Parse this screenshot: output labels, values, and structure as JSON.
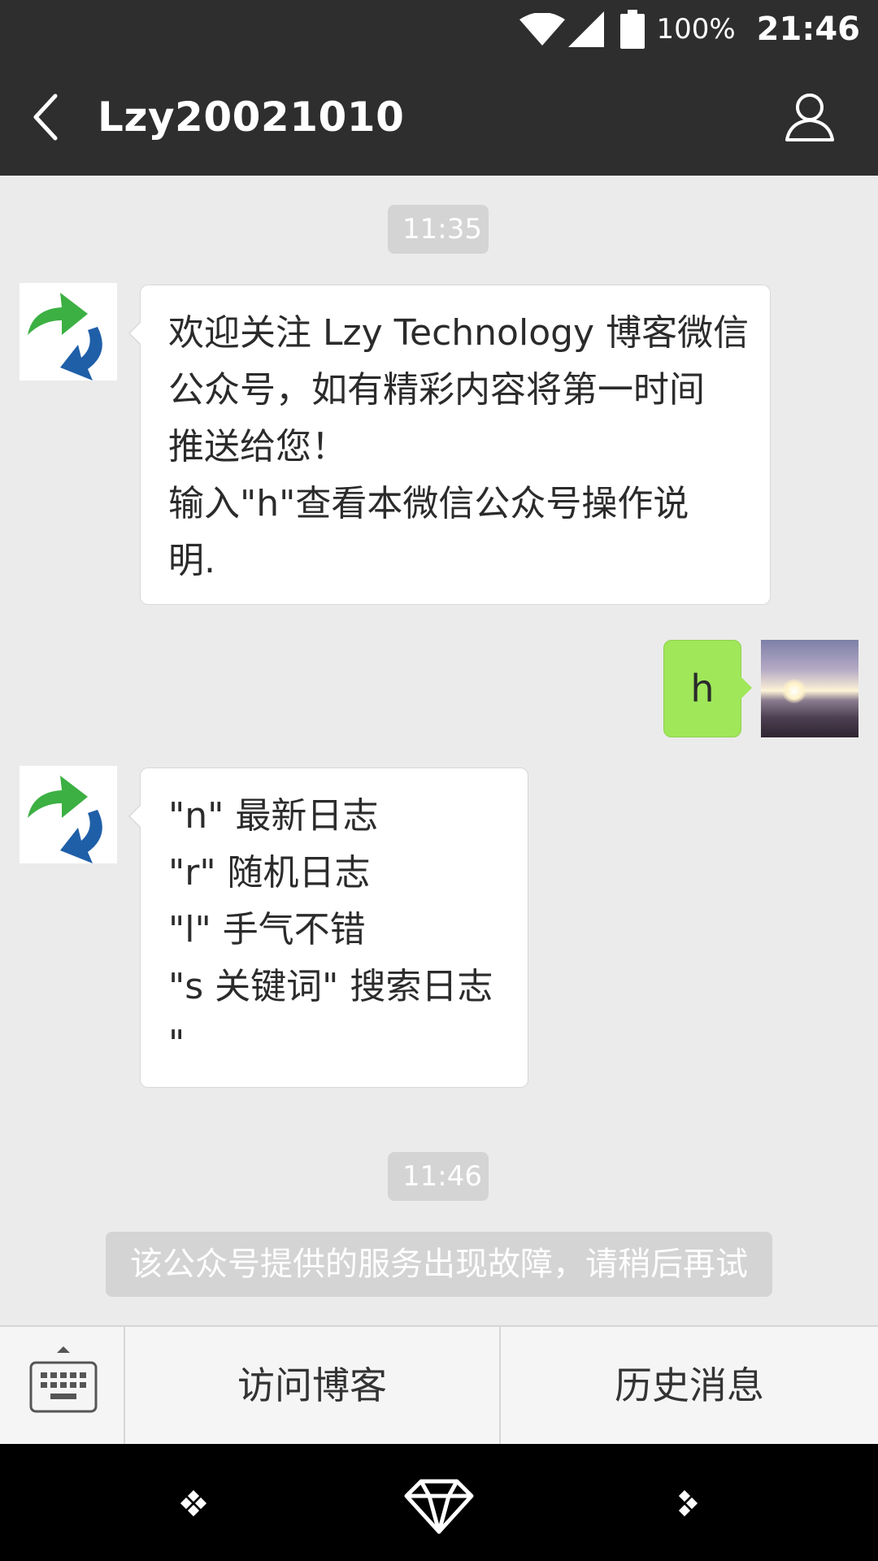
{
  "status_bar": {
    "battery": "100%",
    "time": "21:46",
    "icons": [
      "wifi-icon",
      "signal-icon",
      "battery-icon"
    ]
  },
  "header": {
    "title": "Lzy20021010",
    "back_icon": "chevron-left-icon",
    "profile_icon": "person-icon"
  },
  "chat": {
    "timestamps": [
      "11:35",
      "11:46"
    ],
    "messages": [
      {
        "from": "official-account",
        "lines": [
          "欢迎关注 Lzy Technology 博客微信",
          "公众号，如有精彩内容将第一时间",
          "推送给您！",
          "输入\"h\"查看本微信公众号操作说",
          "明."
        ]
      },
      {
        "from": "me",
        "lines": [
          "h"
        ]
      },
      {
        "from": "official-account",
        "lines": [
          "\"n\" 最新日志",
          "\"r\" 随机日志",
          "\"l\" 手气不错",
          "\"s 关键词\" 搜索日志",
          "\""
        ]
      }
    ],
    "system_notice": "该公众号提供的服务出现故障，请稍后再试"
  },
  "menu": {
    "keyboard_icon": "keyboard-icon",
    "items": [
      "访问博客",
      "历史消息"
    ]
  },
  "nav_bar": {
    "icons": [
      "dots-icon",
      "diamond-icon",
      "dots-icon"
    ]
  },
  "colors": {
    "header_bg": "#2e2e2e",
    "chat_bg": "#ebebeb",
    "sent_bubble": "#a0e75a",
    "received_bubble": "#ffffff",
    "nav_bg": "#000000"
  }
}
